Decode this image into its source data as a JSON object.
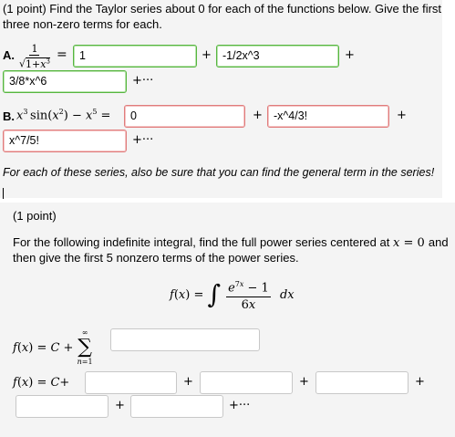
{
  "problem1": {
    "header": "(1 point) Find the Taylor series about 0 for each of the functions below. Give the first",
    "header2": "three non-zero terms for each.",
    "partA": {
      "label": "A.",
      "answers": [
        "1",
        "-1/2x^3",
        "3/8*x^6"
      ],
      "status": [
        "correct",
        "correct",
        "correct"
      ]
    },
    "partB": {
      "label": "B.",
      "answers": [
        "0",
        "-x^4/3!",
        "x^7/5!"
      ],
      "status": [
        "incorrect",
        "incorrect",
        "incorrect"
      ]
    },
    "plus": "+",
    "ellipsis": "+···",
    "note": "For each of these series, also be sure that you can find the general term in the series!"
  },
  "problem2": {
    "points": "(1 point)",
    "text1": "For the following indefinite integral, find the full power series centered at",
    "text1b": "and",
    "text2": "then give the first 5 nonzero terms of the power series.",
    "sum_value": "",
    "terms": [
      "",
      "",
      "",
      "",
      ""
    ],
    "plus": "+",
    "ellipsis": "+···"
  },
  "colors": {
    "correct": "#56b63f",
    "incorrect": "#e07c7c",
    "panel": "#f4f4f4"
  }
}
